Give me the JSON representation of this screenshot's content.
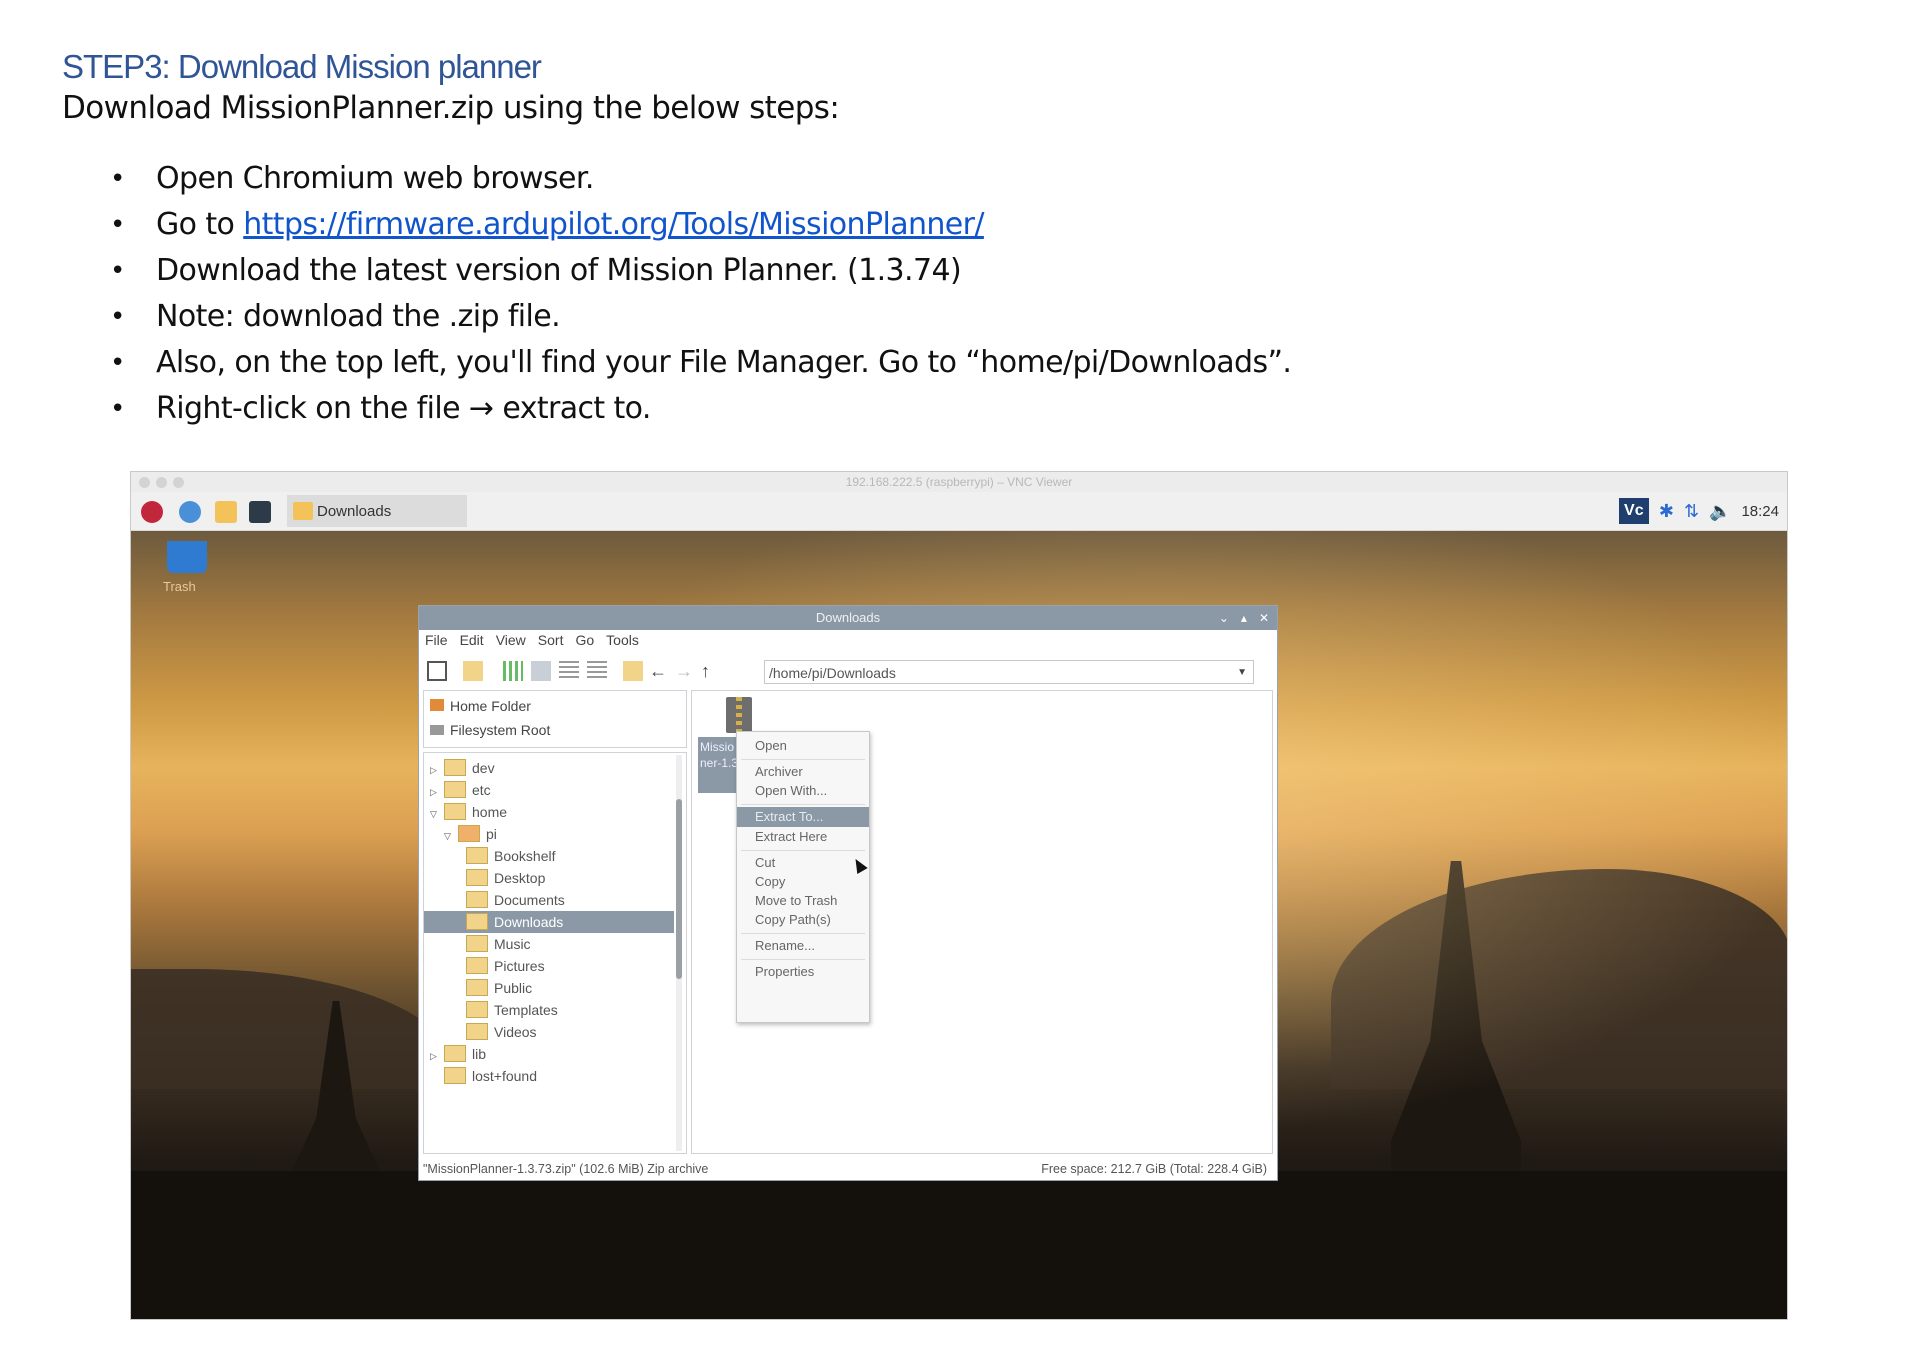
{
  "document": {
    "title": "STEP3: Download Mission planner",
    "intro": "Download MissionPlanner.zip using the below steps:",
    "bullet": "•",
    "steps": [
      {
        "text": "Open Chromium web browser."
      },
      {
        "text": "Go to ",
        "link": "https://firmware.ardupilot.org/Tools/MissionPlanner/"
      },
      {
        "text": "Download the latest version of Mission Planner. (1.3.74)"
      },
      {
        "text": "Note: download the .zip file."
      },
      {
        "text": "Also, on the top left, you'll find your File Manager. Go to “home/pi/Downloads”."
      },
      {
        "text": "Right-click on the file → extract to."
      }
    ]
  },
  "vnc": {
    "window_title": "192.168.222.5 (raspberrypi) – VNC Viewer"
  },
  "taskbar": {
    "window_button_label": "Downloads",
    "vnc_icon_text": "Vc",
    "bluetooth_glyph": "✱",
    "network_glyph": "⇅",
    "volume_glyph": "🔈",
    "clock": "18:24"
  },
  "desktop": {
    "trash_label": "Trash"
  },
  "file_manager": {
    "title": "Downloads",
    "title_controls": [
      "⌄",
      "▴",
      "✕"
    ],
    "menu": [
      "File",
      "Edit",
      "View",
      "Sort",
      "Go",
      "Tools"
    ],
    "path": "/home/pi/Downloads",
    "path_dropdown": "▼",
    "places": [
      "Home Folder",
      "Filesystem Root"
    ],
    "tree": [
      {
        "label": "dev",
        "arrow": "▷"
      },
      {
        "label": "etc",
        "arrow": "▷"
      },
      {
        "label": "home",
        "arrow": "▽"
      },
      {
        "label": "pi",
        "arrow": "▽"
      },
      {
        "label": "Bookshelf",
        "arrow": ""
      },
      {
        "label": "Desktop",
        "arrow": ""
      },
      {
        "label": "Documents",
        "arrow": ""
      },
      {
        "label": "Downloads",
        "arrow": ""
      },
      {
        "label": "Music",
        "arrow": ""
      },
      {
        "label": "Pictures",
        "arrow": ""
      },
      {
        "label": "Public",
        "arrow": ""
      },
      {
        "label": "Templates",
        "arrow": ""
      },
      {
        "label": "Videos",
        "arrow": ""
      },
      {
        "label": "lib",
        "arrow": "▷"
      },
      {
        "label": "lost+found",
        "arrow": ""
      }
    ],
    "selected_file_label": "Missio ner-1.3 p",
    "context_menu": [
      "Open",
      "Archiver",
      "Open With...",
      "Extract To...",
      "Extract Here",
      "Cut",
      "Copy",
      "Move to Trash",
      "Copy Path(s)",
      "Rename...",
      "Properties"
    ],
    "status_left": "\"MissionPlanner-1.3.73.zip\" (102.6 MiB) Zip archive",
    "status_right": "Free space: 212.7 GiB (Total: 228.4 GiB)"
  },
  "colors": {
    "heading": "#2f5597",
    "link": "#1155cc",
    "selection": "#8b98a6"
  }
}
